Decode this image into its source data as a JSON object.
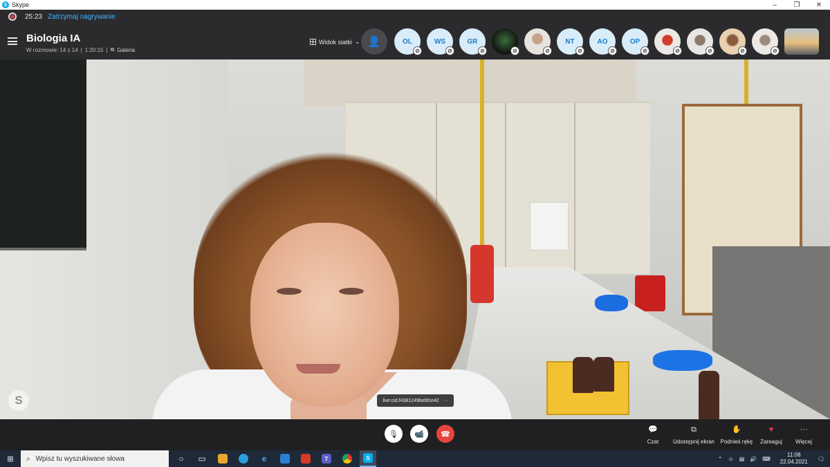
{
  "window": {
    "app_title": "Skype",
    "controls": [
      "–",
      "❐",
      "✕"
    ]
  },
  "recording": {
    "time": "25:23",
    "stop_label": "Zatrzymaj nagrywanie"
  },
  "conversation": {
    "title": "Biologia IA",
    "participants_info": "W rozmowie: 14 z 14",
    "duration": "1:20:15",
    "separator": "|",
    "gallery_label": "Galeria"
  },
  "view_selector": {
    "label": "Widok siatki",
    "chevron": "⌄"
  },
  "participants": [
    {
      "initials": "OL",
      "type": "initials"
    },
    {
      "initials": "WS",
      "type": "initials"
    },
    {
      "initials": "GR",
      "type": "initials"
    },
    {
      "initials": "",
      "type": "photo"
    },
    {
      "initials": "",
      "type": "photo"
    },
    {
      "initials": "NT",
      "type": "initials"
    },
    {
      "initials": "AO",
      "type": "initials"
    },
    {
      "initials": "OP",
      "type": "initials"
    },
    {
      "initials": "",
      "type": "photo"
    },
    {
      "initials": "",
      "type": "photo"
    },
    {
      "initials": "",
      "type": "photo"
    },
    {
      "initials": "",
      "type": "photo"
    },
    {
      "initials": "",
      "type": "video"
    }
  ],
  "video": {
    "speaker_tag": "live:cid.f4381249bebfce42",
    "more": "···",
    "watermark": "S"
  },
  "call_controls": {
    "mic": "🎙",
    "camera": "📹",
    "hangup": "☎"
  },
  "actions": [
    {
      "label": "Czat",
      "icon": "💬"
    },
    {
      "label": "Udostępnij ekran",
      "icon": "⧉"
    },
    {
      "label": "Podnieś rękę",
      "icon": "✋"
    },
    {
      "label": "Zareaguj",
      "icon": "♥"
    },
    {
      "label": "Więcej",
      "icon": "···"
    }
  ],
  "taskbar": {
    "search_placeholder": "Wpisz tu wyszukiwane słowa",
    "time": "11:08",
    "date": "22.04.2021"
  },
  "colors": {
    "accent_blue": "#3fb6ff",
    "recording_red": "#e0383e",
    "hangup_red": "#e6453d",
    "header_bg": "#2b2b2e",
    "taskbar_bg": "#1f2a38"
  }
}
